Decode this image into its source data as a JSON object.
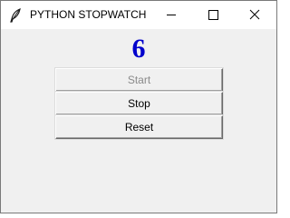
{
  "window": {
    "title": "PYTHON STOPWATCH",
    "controls": {
      "minimize_icon": "minimize-icon",
      "maximize_icon": "maximize-icon",
      "close_icon": "close-icon"
    }
  },
  "display": {
    "counter": "6",
    "color": "#0000cc"
  },
  "buttons": {
    "start": {
      "label": "Start",
      "enabled": false
    },
    "stop": {
      "label": "Stop",
      "enabled": true
    },
    "reset": {
      "label": "Reset",
      "enabled": true
    }
  }
}
